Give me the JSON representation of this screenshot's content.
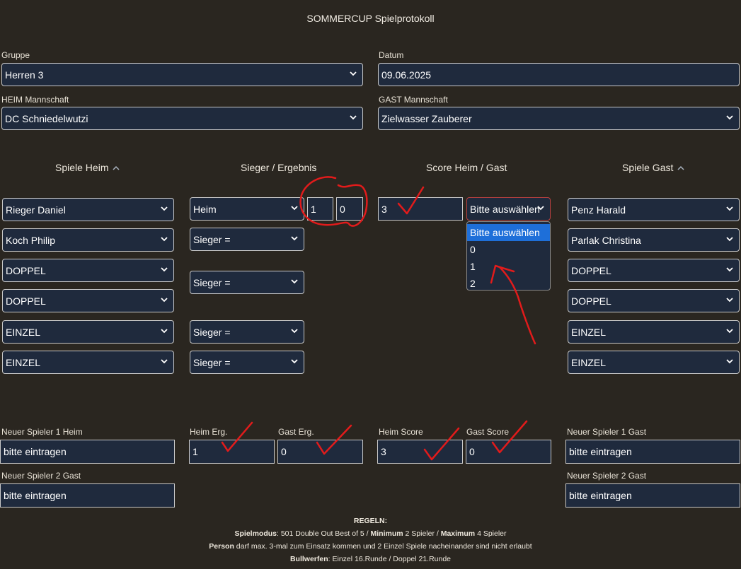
{
  "page": {
    "title": "SOMMERCUP Spielprotokoll"
  },
  "header": {
    "gruppe": {
      "label": "Gruppe",
      "value": "Herren 3"
    },
    "datum": {
      "label": "Datum",
      "value": "09.06.2025"
    },
    "heim": {
      "label": "HEIM Mannschaft",
      "value": "DC Schniedelwutzi"
    },
    "gast": {
      "label": "GAST Mannschaft",
      "value": "Zielwasser Zauberer"
    }
  },
  "columns": {
    "spiele_heim": "Spiele Heim",
    "sieger_ergebnis": "Sieger / Ergebnis",
    "score": "Score Heim / Gast",
    "spiele_gast": "Spiele Gast",
    "sort_icon": "chevron-up-icon"
  },
  "games": {
    "heim_players": [
      "Rieger Daniel",
      "Koch Philip",
      "DOPPEL",
      "DOPPEL",
      "EINZEL",
      "EINZEL"
    ],
    "gast_players": [
      "Penz Harald",
      "Parlak Christina",
      "DOPPEL",
      "DOPPEL",
      "EINZEL",
      "EINZEL"
    ],
    "winner_first": "Heim",
    "winner_others": [
      "Sieger =",
      "Sieger =",
      "Sieger =",
      "Sieger ="
    ],
    "result_heim": "1",
    "result_gast": "0",
    "score_heim": "3",
    "score_gast_select": "Bitte auswählen",
    "dropdown_options": [
      "Bitte auswählen",
      "0",
      "1",
      "2"
    ],
    "dropdown_selected_index": 0
  },
  "bottom": {
    "neuer1_heim": {
      "label": "Neuer Spieler 1 Heim",
      "value": "bitte eintragen"
    },
    "neuer2_heim": {
      "label": "Neuer Spieler 2 Gast",
      "value": "bitte eintragen"
    },
    "heim_erg": {
      "label": "Heim Erg.",
      "value": "1"
    },
    "gast_erg": {
      "label": "Gast Erg.",
      "value": "0"
    },
    "heim_score": {
      "label": "Heim Score",
      "value": "3"
    },
    "gast_score": {
      "label": "Gast Score",
      "value": "0"
    },
    "neuer1_gast": {
      "label": "Neuer Spieler 1 Gast",
      "value": "bitte eintragen"
    },
    "neuer2_gast": {
      "label": "Neuer Spieler 2 Gast",
      "value": "bitte eintragen"
    }
  },
  "rules": {
    "heading": "REGELN:",
    "line1_bold1": "Spielmodus",
    "line1_text1": ": 501 Double Out Best of 5 / ",
    "line1_bold2": "Minimum",
    "line1_text2": " 2 Spieler / ",
    "line1_bold3": "Maximum",
    "line1_text3": " 4 Spieler",
    "line2_bold": "Person",
    "line2_text": " darf max. 3-mal zum Einsatz kommen und 2 Einzel Spiele nacheinander sind nicht erlaubt",
    "line3_bold": "Bullwerfen",
    "line3_text": ": Einzel 16.Runde / Doppel 21.Runde"
  },
  "colors": {
    "background": "#2a2620",
    "field": "#1f2a3d",
    "highlight": "#1e6fd9",
    "annotation": "#e21b1b"
  }
}
